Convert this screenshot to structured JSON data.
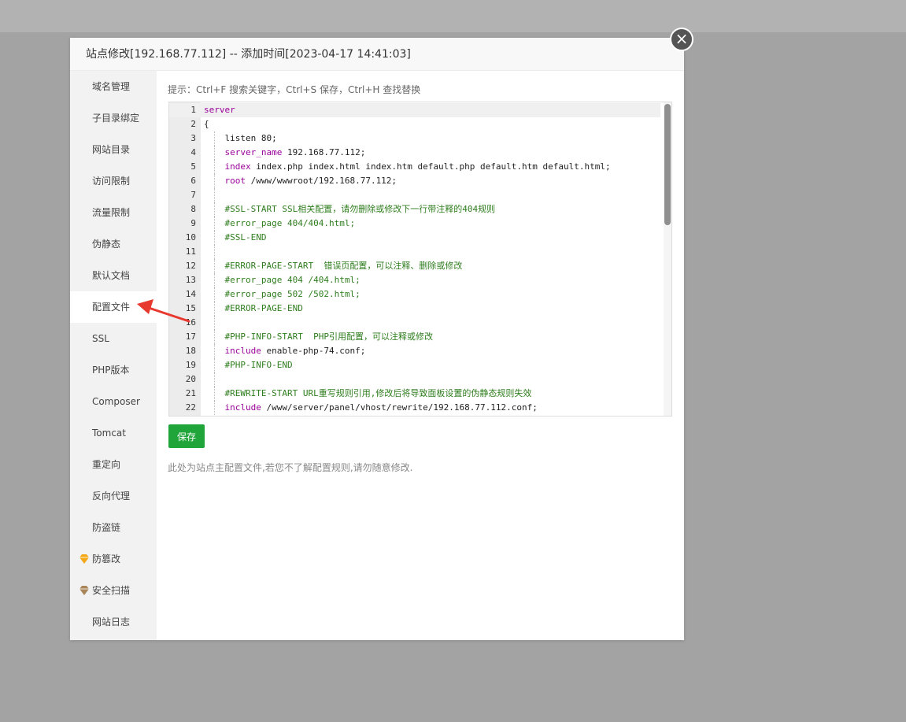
{
  "dialog": {
    "title": "站点修改[192.168.77.112] -- 添加时间[2023-04-17 14:41:03]",
    "close_label": "×"
  },
  "sidebar": {
    "items": [
      {
        "label": "域名管理",
        "icon": null,
        "active": false
      },
      {
        "label": "子目录绑定",
        "icon": null,
        "active": false
      },
      {
        "label": "网站目录",
        "icon": null,
        "active": false
      },
      {
        "label": "访问限制",
        "icon": null,
        "active": false
      },
      {
        "label": "流量限制",
        "icon": null,
        "active": false
      },
      {
        "label": "伪静态",
        "icon": null,
        "active": false
      },
      {
        "label": "默认文档",
        "icon": null,
        "active": false
      },
      {
        "label": "配置文件",
        "icon": null,
        "active": true
      },
      {
        "label": "SSL",
        "icon": null,
        "active": false
      },
      {
        "label": "PHP版本",
        "icon": null,
        "active": false
      },
      {
        "label": "Composer",
        "icon": null,
        "active": false
      },
      {
        "label": "Tomcat",
        "icon": null,
        "active": false
      },
      {
        "label": "重定向",
        "icon": null,
        "active": false
      },
      {
        "label": "反向代理",
        "icon": null,
        "active": false
      },
      {
        "label": "防盗链",
        "icon": null,
        "active": false
      },
      {
        "label": "防篡改",
        "icon": "diamond-gold-icon",
        "active": false
      },
      {
        "label": "安全扫描",
        "icon": "diamond-bronze-icon",
        "active": false
      },
      {
        "label": "网站日志",
        "icon": null,
        "active": false
      }
    ]
  },
  "editor": {
    "tip": "提示：Ctrl+F 搜索关键字，Ctrl+S 保存，Ctrl+H 查找替换",
    "lines": [
      {
        "n": "1",
        "parts": [
          {
            "t": "server",
            "c": "kw"
          }
        ]
      },
      {
        "n": "2",
        "parts": [
          {
            "t": "{",
            "c": ""
          }
        ]
      },
      {
        "n": "3",
        "parts": [
          {
            "t": "    listen 80;",
            "c": ""
          }
        ]
      },
      {
        "n": "4",
        "parts": [
          {
            "t": "    ",
            "c": ""
          },
          {
            "t": "server_name",
            "c": "kw"
          },
          {
            "t": " 192.168.77.112;",
            "c": ""
          }
        ]
      },
      {
        "n": "5",
        "parts": [
          {
            "t": "    ",
            "c": ""
          },
          {
            "t": "index",
            "c": "kw"
          },
          {
            "t": " index.php index.html index.htm default.php default.htm default.html;",
            "c": ""
          }
        ]
      },
      {
        "n": "6",
        "parts": [
          {
            "t": "    ",
            "c": ""
          },
          {
            "t": "root",
            "c": "kw"
          },
          {
            "t": " /www/wwwroot/192.168.77.112;",
            "c": ""
          }
        ]
      },
      {
        "n": "7",
        "parts": []
      },
      {
        "n": "8",
        "parts": [
          {
            "t": "    ",
            "c": ""
          },
          {
            "t": "#SSL-START SSL相关配置，请勿删除或修改下一行带注释的404规则",
            "c": "cm"
          }
        ]
      },
      {
        "n": "9",
        "parts": [
          {
            "t": "    ",
            "c": ""
          },
          {
            "t": "#error_page 404/404.html;",
            "c": "cm"
          }
        ]
      },
      {
        "n": "10",
        "parts": [
          {
            "t": "    ",
            "c": ""
          },
          {
            "t": "#SSL-END",
            "c": "cm"
          }
        ]
      },
      {
        "n": "11",
        "parts": []
      },
      {
        "n": "12",
        "parts": [
          {
            "t": "    ",
            "c": ""
          },
          {
            "t": "#ERROR-PAGE-START  错误页配置，可以注释、删除或修改",
            "c": "cm"
          }
        ]
      },
      {
        "n": "13",
        "parts": [
          {
            "t": "    ",
            "c": ""
          },
          {
            "t": "#error_page 404 /404.html;",
            "c": "cm"
          }
        ]
      },
      {
        "n": "14",
        "parts": [
          {
            "t": "    ",
            "c": ""
          },
          {
            "t": "#error_page 502 /502.html;",
            "c": "cm"
          }
        ]
      },
      {
        "n": "15",
        "parts": [
          {
            "t": "    ",
            "c": ""
          },
          {
            "t": "#ERROR-PAGE-END",
            "c": "cm"
          }
        ]
      },
      {
        "n": "16",
        "parts": []
      },
      {
        "n": "17",
        "parts": [
          {
            "t": "    ",
            "c": ""
          },
          {
            "t": "#PHP-INFO-START  PHP引用配置，可以注释或修改",
            "c": "cm"
          }
        ]
      },
      {
        "n": "18",
        "parts": [
          {
            "t": "    ",
            "c": ""
          },
          {
            "t": "include",
            "c": "kw"
          },
          {
            "t": " enable-php-74.conf;",
            "c": ""
          }
        ]
      },
      {
        "n": "19",
        "parts": [
          {
            "t": "    ",
            "c": ""
          },
          {
            "t": "#PHP-INFO-END",
            "c": "cm"
          }
        ]
      },
      {
        "n": "20",
        "parts": []
      },
      {
        "n": "21",
        "parts": [
          {
            "t": "    ",
            "c": ""
          },
          {
            "t": "#REWRITE-START URL重写规则引用,修改后将导致面板设置的伪静态规则失效",
            "c": "cm"
          }
        ]
      },
      {
        "n": "22",
        "parts": [
          {
            "t": "    ",
            "c": ""
          },
          {
            "t": "include",
            "c": "kw"
          },
          {
            "t": " /www/server/panel/vhost/rewrite/192.168.77.112.conf;",
            "c": ""
          }
        ]
      }
    ],
    "current_line": 1,
    "scroll_fraction_visible": 0.39
  },
  "actions": {
    "save_label": "保存",
    "note": "此处为站点主配置文件,若您不了解配置规则,请勿随意修改."
  },
  "colors": {
    "accent_green": "#20a53a",
    "keyword": "#990099",
    "comment": "#2e7d1d",
    "annotation_arrow": "#e8392f"
  }
}
